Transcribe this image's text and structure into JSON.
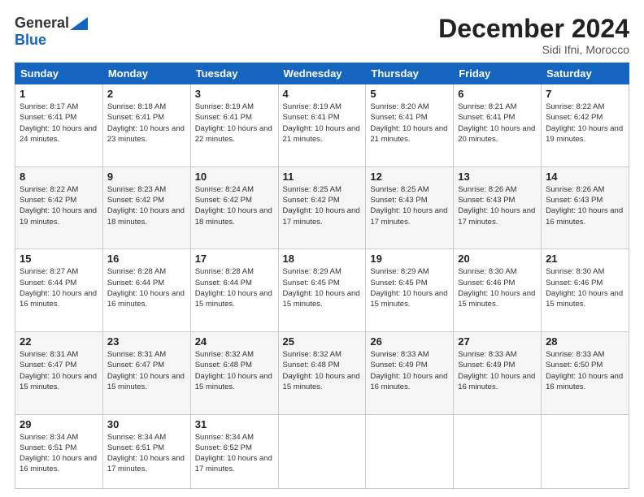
{
  "logo": {
    "general": "General",
    "blue": "Blue"
  },
  "title": "December 2024",
  "location": "Sidi Ifni, Morocco",
  "days_header": [
    "Sunday",
    "Monday",
    "Tuesday",
    "Wednesday",
    "Thursday",
    "Friday",
    "Saturday"
  ],
  "weeks": [
    [
      {
        "day": "1",
        "sunrise": "8:17 AM",
        "sunset": "6:41 PM",
        "daylight": "10 hours and 24 minutes."
      },
      {
        "day": "2",
        "sunrise": "8:18 AM",
        "sunset": "6:41 PM",
        "daylight": "10 hours and 23 minutes."
      },
      {
        "day": "3",
        "sunrise": "8:19 AM",
        "sunset": "6:41 PM",
        "daylight": "10 hours and 22 minutes."
      },
      {
        "day": "4",
        "sunrise": "8:19 AM",
        "sunset": "6:41 PM",
        "daylight": "10 hours and 21 minutes."
      },
      {
        "day": "5",
        "sunrise": "8:20 AM",
        "sunset": "6:41 PM",
        "daylight": "10 hours and 21 minutes."
      },
      {
        "day": "6",
        "sunrise": "8:21 AM",
        "sunset": "6:41 PM",
        "daylight": "10 hours and 20 minutes."
      },
      {
        "day": "7",
        "sunrise": "8:22 AM",
        "sunset": "6:42 PM",
        "daylight": "10 hours and 19 minutes."
      }
    ],
    [
      {
        "day": "8",
        "sunrise": "8:22 AM",
        "sunset": "6:42 PM",
        "daylight": "10 hours and 19 minutes."
      },
      {
        "day": "9",
        "sunrise": "8:23 AM",
        "sunset": "6:42 PM",
        "daylight": "10 hours and 18 minutes."
      },
      {
        "day": "10",
        "sunrise": "8:24 AM",
        "sunset": "6:42 PM",
        "daylight": "10 hours and 18 minutes."
      },
      {
        "day": "11",
        "sunrise": "8:25 AM",
        "sunset": "6:42 PM",
        "daylight": "10 hours and 17 minutes."
      },
      {
        "day": "12",
        "sunrise": "8:25 AM",
        "sunset": "6:43 PM",
        "daylight": "10 hours and 17 minutes."
      },
      {
        "day": "13",
        "sunrise": "8:26 AM",
        "sunset": "6:43 PM",
        "daylight": "10 hours and 17 minutes."
      },
      {
        "day": "14",
        "sunrise": "8:26 AM",
        "sunset": "6:43 PM",
        "daylight": "10 hours and 16 minutes."
      }
    ],
    [
      {
        "day": "15",
        "sunrise": "8:27 AM",
        "sunset": "6:44 PM",
        "daylight": "10 hours and 16 minutes."
      },
      {
        "day": "16",
        "sunrise": "8:28 AM",
        "sunset": "6:44 PM",
        "daylight": "10 hours and 16 minutes."
      },
      {
        "day": "17",
        "sunrise": "8:28 AM",
        "sunset": "6:44 PM",
        "daylight": "10 hours and 15 minutes."
      },
      {
        "day": "18",
        "sunrise": "8:29 AM",
        "sunset": "6:45 PM",
        "daylight": "10 hours and 15 minutes."
      },
      {
        "day": "19",
        "sunrise": "8:29 AM",
        "sunset": "6:45 PM",
        "daylight": "10 hours and 15 minutes."
      },
      {
        "day": "20",
        "sunrise": "8:30 AM",
        "sunset": "6:46 PM",
        "daylight": "10 hours and 15 minutes."
      },
      {
        "day": "21",
        "sunrise": "8:30 AM",
        "sunset": "6:46 PM",
        "daylight": "10 hours and 15 minutes."
      }
    ],
    [
      {
        "day": "22",
        "sunrise": "8:31 AM",
        "sunset": "6:47 PM",
        "daylight": "10 hours and 15 minutes."
      },
      {
        "day": "23",
        "sunrise": "8:31 AM",
        "sunset": "6:47 PM",
        "daylight": "10 hours and 15 minutes."
      },
      {
        "day": "24",
        "sunrise": "8:32 AM",
        "sunset": "6:48 PM",
        "daylight": "10 hours and 15 minutes."
      },
      {
        "day": "25",
        "sunrise": "8:32 AM",
        "sunset": "6:48 PM",
        "daylight": "10 hours and 15 minutes."
      },
      {
        "day": "26",
        "sunrise": "8:33 AM",
        "sunset": "6:49 PM",
        "daylight": "10 hours and 16 minutes."
      },
      {
        "day": "27",
        "sunrise": "8:33 AM",
        "sunset": "6:49 PM",
        "daylight": "10 hours and 16 minutes."
      },
      {
        "day": "28",
        "sunrise": "8:33 AM",
        "sunset": "6:50 PM",
        "daylight": "10 hours and 16 minutes."
      }
    ],
    [
      {
        "day": "29",
        "sunrise": "8:34 AM",
        "sunset": "6:51 PM",
        "daylight": "10 hours and 16 minutes."
      },
      {
        "day": "30",
        "sunrise": "8:34 AM",
        "sunset": "6:51 PM",
        "daylight": "10 hours and 17 minutes."
      },
      {
        "day": "31",
        "sunrise": "8:34 AM",
        "sunset": "6:52 PM",
        "daylight": "10 hours and 17 minutes."
      },
      null,
      null,
      null,
      null
    ]
  ]
}
